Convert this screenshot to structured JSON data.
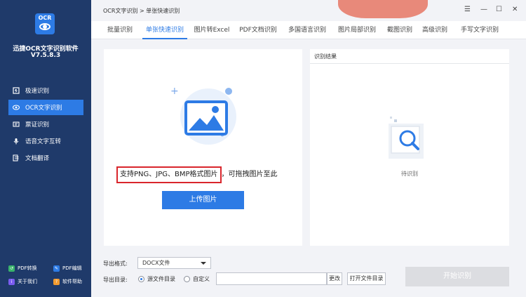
{
  "app": {
    "logo_text": "OCR",
    "name": "迅捷OCR文字识别软件",
    "version": "V7.5.8.3"
  },
  "sidebar": {
    "items": [
      {
        "label": "极速识别",
        "icon": "lightning-icon",
        "active": false
      },
      {
        "label": "OCR文字识别",
        "icon": "eye-icon",
        "active": true
      },
      {
        "label": "票证识别",
        "icon": "ticket-icon",
        "active": false
      },
      {
        "label": "语音文字互转",
        "icon": "microphone-icon",
        "active": false
      },
      {
        "label": "文档翻译",
        "icon": "translate-icon",
        "active": false
      }
    ],
    "bottom_links": [
      {
        "label": "PDF转换",
        "color": "#39b36b"
      },
      {
        "label": "PDF编辑",
        "color": "#2d7be5"
      },
      {
        "label": "关于我们",
        "color": "#7a5cf0"
      },
      {
        "label": "软件帮助",
        "color": "#f29b30"
      }
    ]
  },
  "header": {
    "breadcrumb": "OCR文字识别 > 单张快速识别"
  },
  "tabs": [
    {
      "label": "批量识别",
      "active": false
    },
    {
      "label": "单张快速识别",
      "active": true
    },
    {
      "label": "图片转Excel",
      "active": false
    },
    {
      "label": "PDF文档识别",
      "active": false
    },
    {
      "label": "多国语言识别",
      "active": false
    },
    {
      "label": "图片局部识别",
      "active": false
    },
    {
      "label": "截图识别",
      "active": false
    },
    {
      "label": "高级识别",
      "active": false
    },
    {
      "label": "手写文字识别",
      "active": false
    }
  ],
  "upload": {
    "hint_boxed": "支持PNG、JPG、BMP格式图片",
    "hint_rest": "，可拖拽图片至此",
    "button_label": "上传图片"
  },
  "result": {
    "title": "识别结果",
    "status": "待识别"
  },
  "bottom": {
    "format_label": "导出格式:",
    "format_value": "DOCX文件",
    "dir_label": "导出目录:",
    "radio_source": "源文件目录",
    "radio_custom": "自定义",
    "change_button": "更改",
    "open_folder_button": "打开文件目录",
    "start_button": "开始识别"
  },
  "colors": {
    "sidebar_bg": "#1f3a6a",
    "accent": "#2d7be5",
    "highlight_box": "#d9262c"
  }
}
